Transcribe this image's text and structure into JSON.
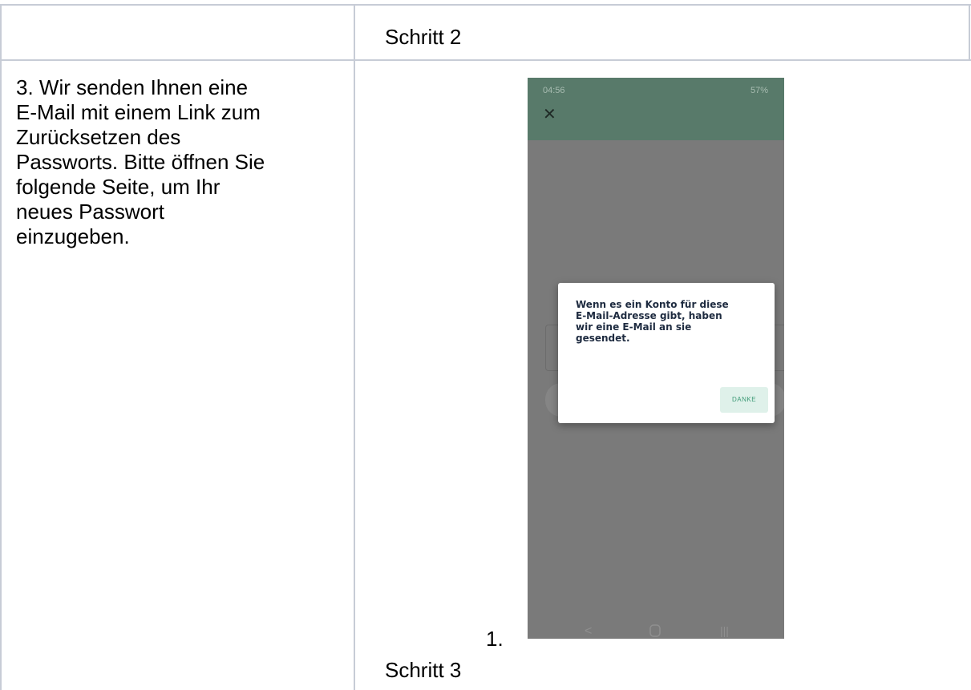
{
  "table": {
    "row1": {
      "col2": "Schritt 2"
    },
    "row2": {
      "col1_lines": [
        "3. Wir senden Ihnen eine",
        "E-Mail mit einem Link zum",
        "Zurücksetzen des",
        "Passworts. Bitte öffnen Sie",
        "folgende Seite, um Ihr",
        "neues Passwort",
        "einzugeben."
      ],
      "list_marker": "1.",
      "col2_footer": "Schritt 3"
    }
  },
  "phone": {
    "status_time": "04:56",
    "status_icons": "57%",
    "close_icon": "close-icon",
    "dialog": {
      "message_lines": [
        "Wenn es ein Konto für diese",
        "E-Mail-Adresse gibt, haben",
        "wir eine E-Mail an sie",
        "gesendet."
      ],
      "button": "DANKE"
    },
    "nav_icons": [
      "back-icon",
      "home-icon",
      "recents-icon"
    ]
  },
  "colors": {
    "table_border": "#c7ccd6",
    "appbar": "#587a6a",
    "dialog_button_bg": "#dff1ea",
    "dialog_button_text": "#3d9a76"
  }
}
